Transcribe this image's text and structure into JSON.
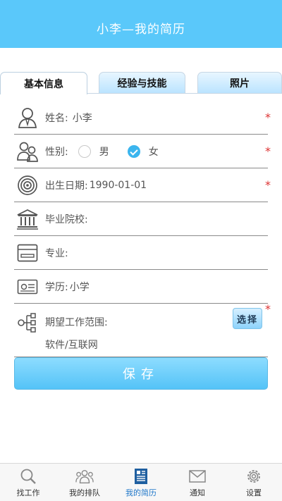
{
  "header": {
    "title": "小李—我的简历"
  },
  "tabs": [
    {
      "label": "基本信息",
      "active": true
    },
    {
      "label": "经验与技能",
      "active": false
    },
    {
      "label": "照片",
      "active": false
    }
  ],
  "form": {
    "name": {
      "label": "姓名:",
      "value": "小李",
      "required": "*"
    },
    "gender": {
      "label": "性别:",
      "options": [
        "男",
        "女"
      ],
      "selected": "女",
      "required": "*"
    },
    "birthday": {
      "label": "出生日期:",
      "value": "1990-01-01",
      "required": "*"
    },
    "school": {
      "label": "毕业院校:",
      "value": ""
    },
    "major": {
      "label": "专业:",
      "value": ""
    },
    "education": {
      "label": "学历:",
      "value": "小学"
    },
    "job_scope": {
      "label": "期望工作范围:",
      "value": "软件/互联网",
      "button": "选择",
      "required": "*"
    }
  },
  "save_button": "保存",
  "bottom_nav": [
    {
      "label": "找工作",
      "icon": "search-icon"
    },
    {
      "label": "我的排队",
      "icon": "people-icon"
    },
    {
      "label": "我的简历",
      "icon": "resume-icon",
      "active": true
    },
    {
      "label": "通知",
      "icon": "envelope-icon"
    },
    {
      "label": "设置",
      "icon": "gear-icon"
    }
  ],
  "colors": {
    "header": "#5ac8fa",
    "accent": "#3bb5ee",
    "required": "#dd3333",
    "nav_active": "#1f77c9"
  }
}
